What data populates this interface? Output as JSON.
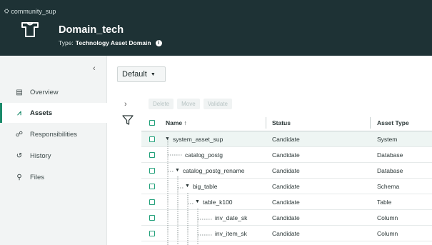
{
  "header": {
    "community": "community_sup",
    "title": "Domain_tech",
    "type_label": "Type:",
    "type_value": "Technology Asset Domain"
  },
  "sidebar": {
    "items": [
      {
        "label": "Overview",
        "icon": "overview-icon"
      },
      {
        "label": "Assets",
        "icon": "assets-icon",
        "active": true
      },
      {
        "label": "Responsibilities",
        "icon": "responsibilities-icon"
      },
      {
        "label": "History",
        "icon": "history-icon"
      },
      {
        "label": "Files",
        "icon": "files-icon"
      }
    ]
  },
  "view": {
    "selected": "Default"
  },
  "toolbar": {
    "delete": "Delete",
    "move": "Move",
    "validate": "Validate"
  },
  "table": {
    "columns": {
      "name": "Name",
      "name_sort": "↑",
      "status": "Status",
      "type": "Asset Type"
    },
    "rows": [
      {
        "name": "system_asset_sup",
        "status": "Candidate",
        "type": "System"
      },
      {
        "name": "catalog_postg",
        "status": "Candidate",
        "type": "Database"
      },
      {
        "name": "catalog_postg_rename",
        "status": "Candidate",
        "type": "Database"
      },
      {
        "name": "big_table",
        "status": "Candidate",
        "type": "Schema"
      },
      {
        "name": "table_k100",
        "status": "Candidate",
        "type": "Table"
      },
      {
        "name": "inv_date_sk",
        "status": "Candidate",
        "type": "Column"
      },
      {
        "name": "inv_item_sk",
        "status": "Candidate",
        "type": "Column"
      }
    ]
  },
  "colors": {
    "header_bg": "#1e3235",
    "accent": "#1a8a6a",
    "checkbox": "#21a07a"
  }
}
